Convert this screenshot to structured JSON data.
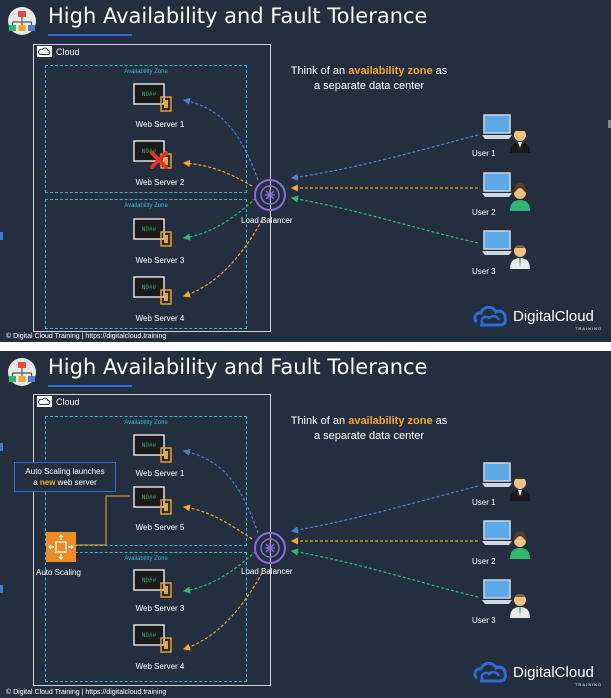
{
  "slides": [
    {
      "title": "High Availability and Fault Tolerance",
      "cloud_label": "Cloud",
      "az_labels": [
        "Availability Zone",
        "Availability Zone"
      ],
      "servers": [
        {
          "label": "Web Server 1",
          "failed": false
        },
        {
          "label": "Web Server 2",
          "failed": true
        },
        {
          "label": "Web Server 3",
          "failed": false
        },
        {
          "label": "Web Server 4",
          "failed": false
        }
      ],
      "load_balancer": "Load Balancer",
      "users": [
        "User 1",
        "User 2",
        "User 3"
      ],
      "note": {
        "pre": "Think of an ",
        "highlight": "availability zone",
        "post": " as",
        "line2": "a separate data center"
      },
      "footer": "© Digital Cloud Training  |  https://digitalcloud.training",
      "brand": "DigitalCloud",
      "brand_sub": "TRAINING"
    },
    {
      "title": "High Availability and Fault Tolerance",
      "cloud_label": "Cloud",
      "az_labels": [
        "Availability Zone",
        "Availability Zone"
      ],
      "servers": [
        {
          "label": "Web Server 1",
          "failed": false
        },
        {
          "label": "Web Server 5",
          "failed": false
        },
        {
          "label": "Web Server 3",
          "failed": false
        },
        {
          "label": "Web Server 4",
          "failed": false
        }
      ],
      "load_balancer": "Load Balancer",
      "users": [
        "User 1",
        "User 2",
        "User 3"
      ],
      "note": {
        "pre": "Think of an ",
        "highlight": "availability zone",
        "post": " as",
        "line2": "a separate data center"
      },
      "callout": {
        "line1": "Auto Scaling launches",
        "pre": "a ",
        "highlight": "new",
        "post": " web server"
      },
      "auto_scaling": "Auto Scaling",
      "footer": "© Digital Cloud Training  |  https://digitalcloud.training",
      "brand": "DigitalCloud",
      "brand_sub": "TRAINING"
    }
  ],
  "colors": {
    "background": "#232f3e",
    "accent_orange": "#f5a623",
    "az_border": "#3bb6d3",
    "arrow_blue": "#4a7fd4",
    "arrow_green": "#2eb872",
    "title_underline": "#2e6bd8",
    "fail_x": "#e0322b"
  }
}
